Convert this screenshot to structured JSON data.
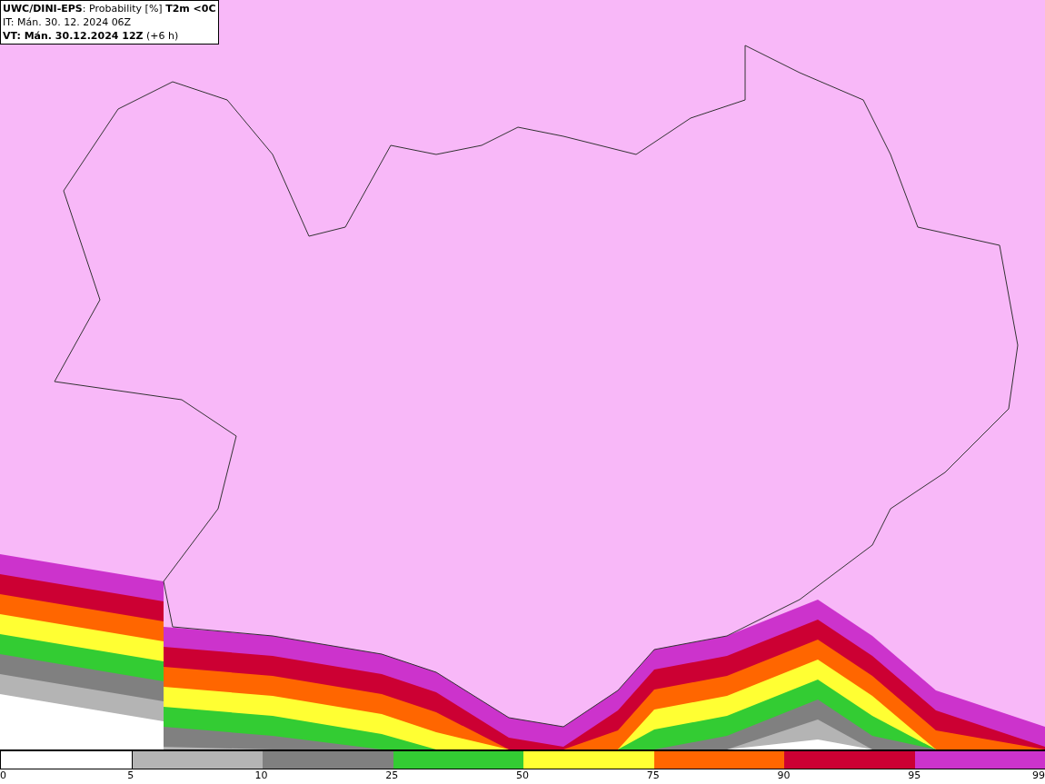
{
  "title_box": {
    "lines": [
      "**UWC/DINI-EPS**: Probability [%] **T2m <0C**",
      "IT: Mán. 30. 12. 2024 06Z",
      "**VT: Mán. 30.12.2024 12Z** (+6 h)"
    ]
  },
  "legend": {
    "segments": [
      {
        "color": "#ffffff"
      },
      {
        "color": "#b4b4b4"
      },
      {
        "color": "#808080"
      },
      {
        "color": "#33cc33"
      },
      {
        "color": "#ffff33"
      },
      {
        "color": "#ff6600"
      },
      {
        "color": "#cc0033"
      },
      {
        "color": "#cc33cc"
      }
    ],
    "ticks": [
      "0",
      "5",
      "10",
      "25",
      "50",
      "75",
      "90",
      "95",
      "99"
    ]
  }
}
